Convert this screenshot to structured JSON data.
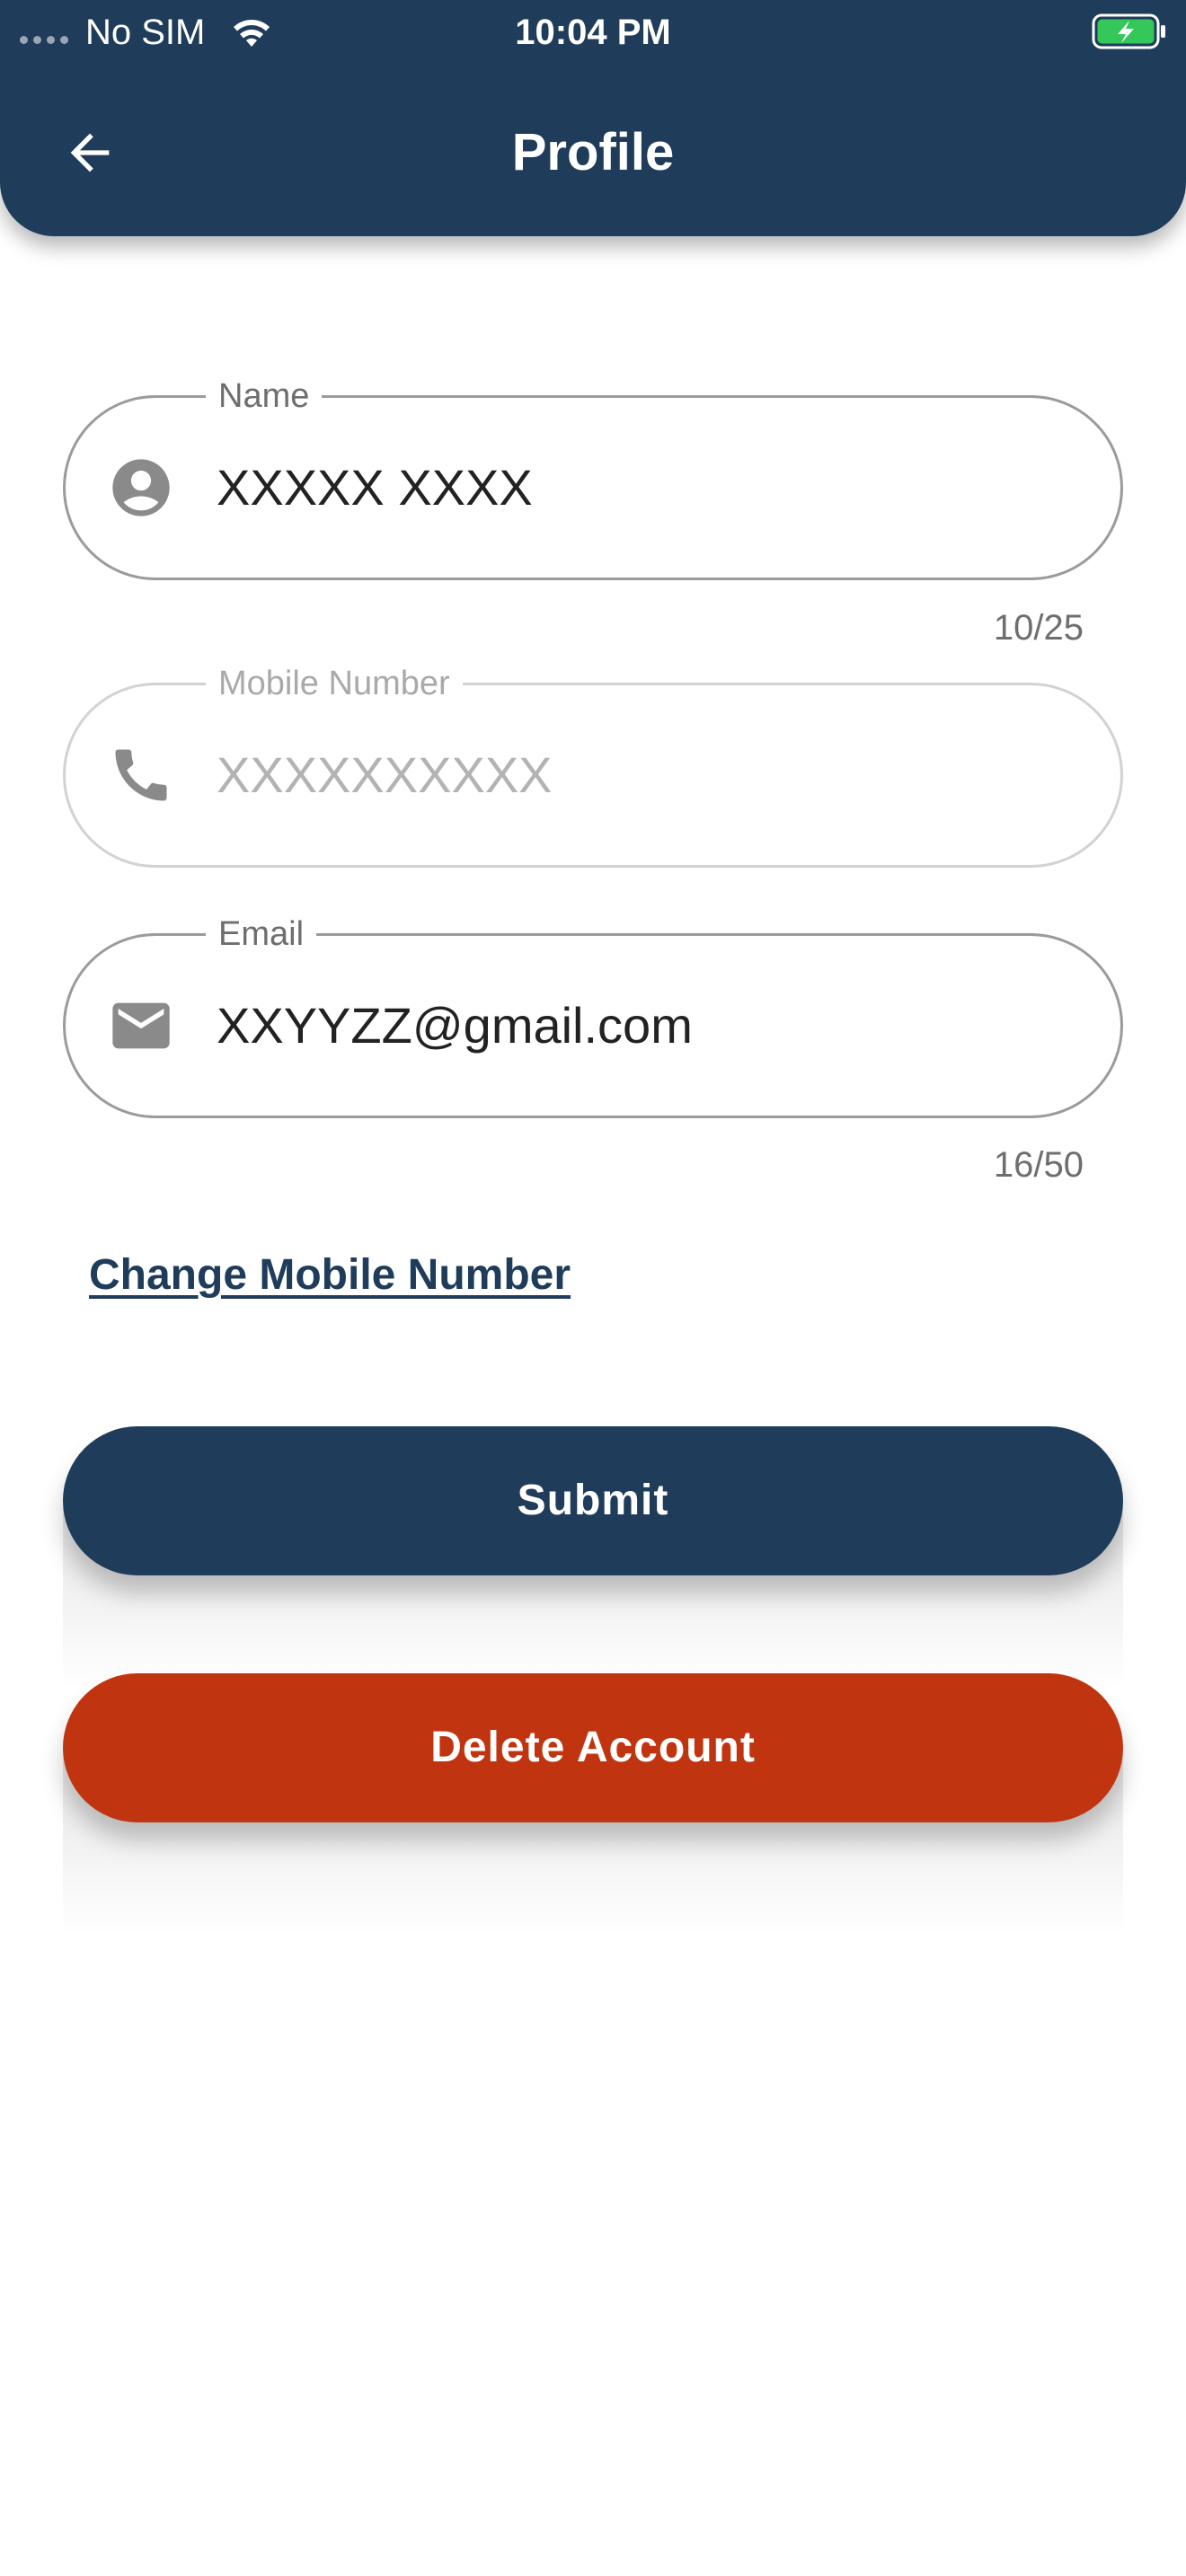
{
  "status_bar": {
    "carrier": "No SIM",
    "time": "10:04 PM"
  },
  "header": {
    "title": "Profile",
    "back_icon": "arrow-left-icon"
  },
  "form": {
    "name": {
      "label": "Name",
      "value": "XXXXX XXXX",
      "icon": "account-circle-icon",
      "counter": "10/25"
    },
    "mobile": {
      "label": "Mobile Number",
      "value": "XXXXXXXXXX",
      "icon": "phone-icon",
      "disabled": true
    },
    "email": {
      "label": "Email",
      "value": "XXYYZZ@gmail.com",
      "icon": "mail-icon",
      "counter": "16/50"
    }
  },
  "links": {
    "change_mobile": "Change Mobile Number"
  },
  "buttons": {
    "submit": "Submit",
    "delete_account": "Delete Account"
  },
  "colors": {
    "primary": "#1f3c5a",
    "danger": "#c0350f",
    "battery": "#34c759"
  }
}
